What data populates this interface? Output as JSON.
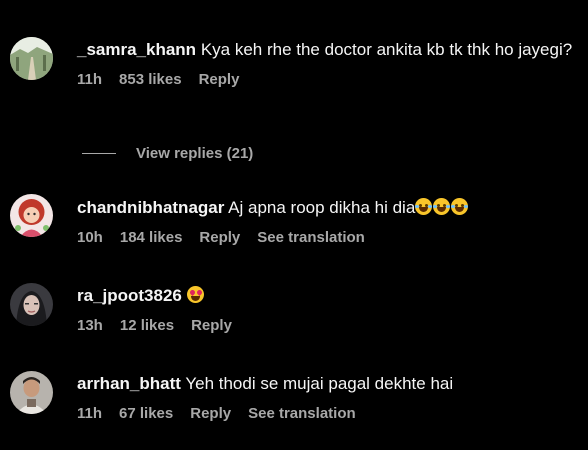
{
  "comments": [
    {
      "username": "_samra_khann",
      "text": "Kya keh rhe the doctor ankita kb tk thk ho jayegi?",
      "time": "11h",
      "likes": "853 likes",
      "reply": "Reply",
      "view_replies": "View replies (21)"
    },
    {
      "username": "chandnibhatnagar",
      "text": "Aj apna roop dikha hi dia",
      "emoji": [
        "face-with-tears-of-joy",
        "face-with-tears-of-joy",
        "face-with-tears-of-joy"
      ],
      "time": "10h",
      "likes": "184 likes",
      "reply": "Reply",
      "translation": "See translation"
    },
    {
      "username": "ra_jpoot3826",
      "text": "",
      "emoji": [
        "smiling-face-with-heart-eyes"
      ],
      "time": "13h",
      "likes": "12 likes",
      "reply": "Reply"
    },
    {
      "username": "arrhan_bhatt",
      "text": "Yeh thodi se mujai pagal dekhte hai",
      "time": "11h",
      "likes": "67 likes",
      "reply": "Reply",
      "translation": "See translation"
    }
  ],
  "colors": {
    "background": "#000000",
    "primary_text": "#f5f5f5",
    "secondary_text": "#a8a8a8"
  }
}
